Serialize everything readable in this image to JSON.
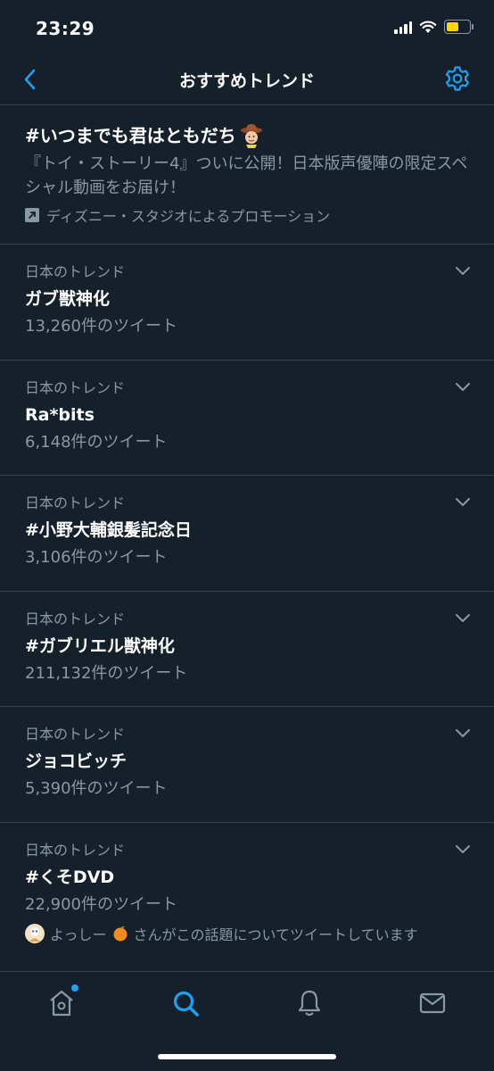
{
  "status_bar": {
    "time": "23:29"
  },
  "nav": {
    "title": "おすすめトレンド"
  },
  "promo": {
    "title": "#いつまでも君はともだち",
    "description": "『トイ・ストーリー4』ついに公開！日本版声優陣の限定スペシャル動画をお届け！",
    "promoted_by": "ディズニー・スタジオによるプロモーション"
  },
  "trends": [
    {
      "context": "日本のトレンド",
      "name": "ガブ獣神化",
      "count": "13,260件のツイート"
    },
    {
      "context": "日本のトレンド",
      "name": "Ra*bits",
      "count": "6,148件のツイート"
    },
    {
      "context": "日本のトレンド",
      "name": "#小野大輔銀髪記念日",
      "count": "3,106件のツイート"
    },
    {
      "context": "日本のトレンド",
      "name": "#ガブリエル獣神化",
      "count": "211,132件のツイート"
    },
    {
      "context": "日本のトレンド",
      "name": "ジョコビッチ",
      "count": "5,390件のツイート"
    },
    {
      "context": "日本のトレンド",
      "name": "#くそDVD",
      "count": "22,900件のツイート",
      "social": {
        "user": "よっしー",
        "text": "さんがこの話題についてツイートしています"
      }
    }
  ],
  "colors": {
    "background": "#15202b",
    "accent": "#1da1f2",
    "secondary_text": "#8899a6",
    "divider": "#38444d"
  },
  "tab_bar": {
    "icons": [
      "home-icon",
      "search-icon",
      "notifications-icon",
      "messages-icon"
    ],
    "active": "search-icon"
  }
}
